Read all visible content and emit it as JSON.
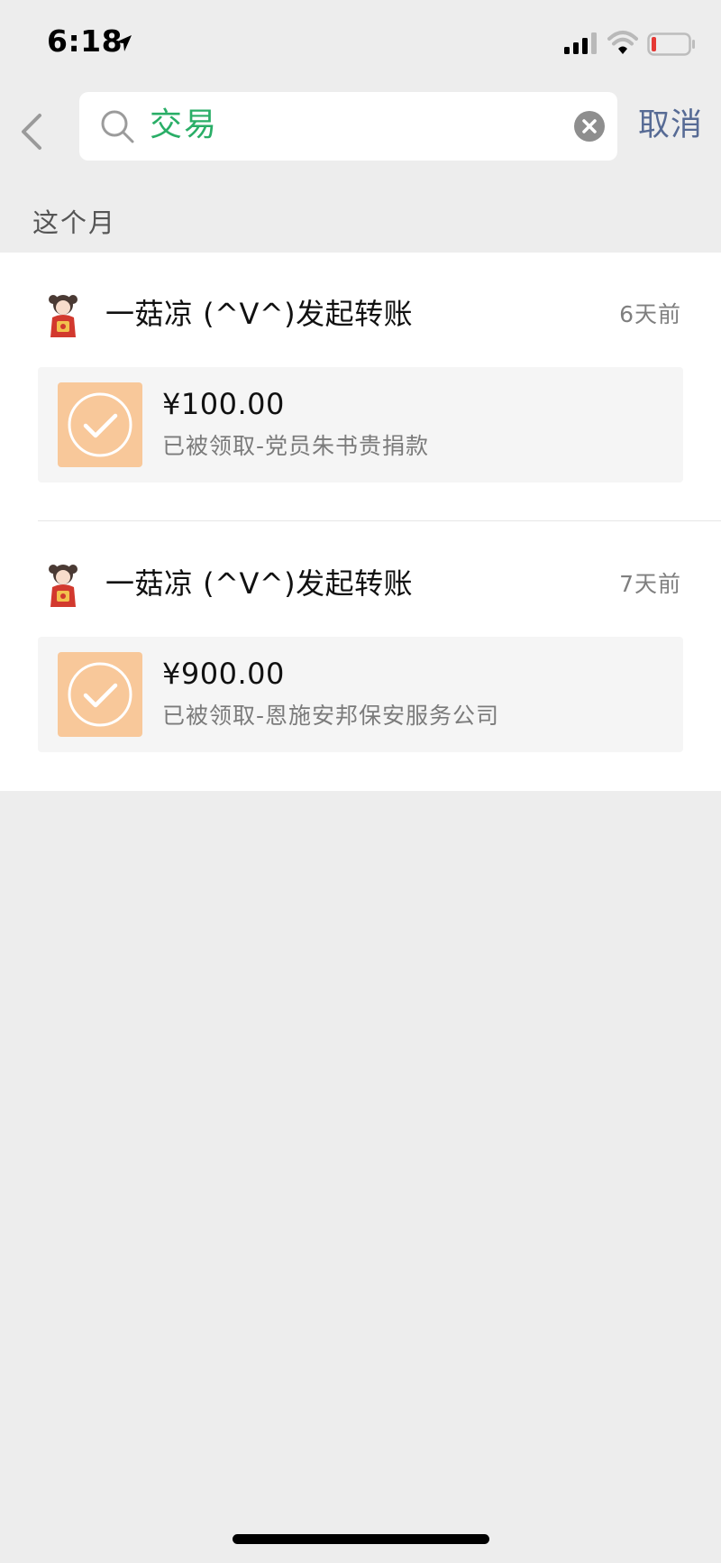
{
  "status_bar": {
    "time": "6:18",
    "location_icon": "location-arrow-icon",
    "signal_icon": "cellular-signal-icon",
    "wifi_icon": "wifi-icon",
    "battery_icon": "battery-low-icon",
    "battery_color": "#e53935"
  },
  "header": {
    "back_icon": "chevron-left-icon",
    "search_icon": "search-icon",
    "search_value": "交易",
    "clear_icon": "clear-icon",
    "cancel_label": "取消"
  },
  "section": {
    "title": "这个月"
  },
  "transactions": [
    {
      "title": "一菇凉 (^V^)发起转账",
      "time": "6天前",
      "amount": "¥100.00",
      "note": "已被领取-党员朱书贵捐款"
    },
    {
      "title": "一菇凉 (^V^)发起转账",
      "time": "7天前",
      "amount": "¥900.00",
      "note": "已被领取-恩施安邦保安服务公司"
    }
  ],
  "colors": {
    "accent_green": "#2aae67",
    "link_blue": "#576b95",
    "transfer_orange": "#f8c89a",
    "background": "#ededed"
  }
}
